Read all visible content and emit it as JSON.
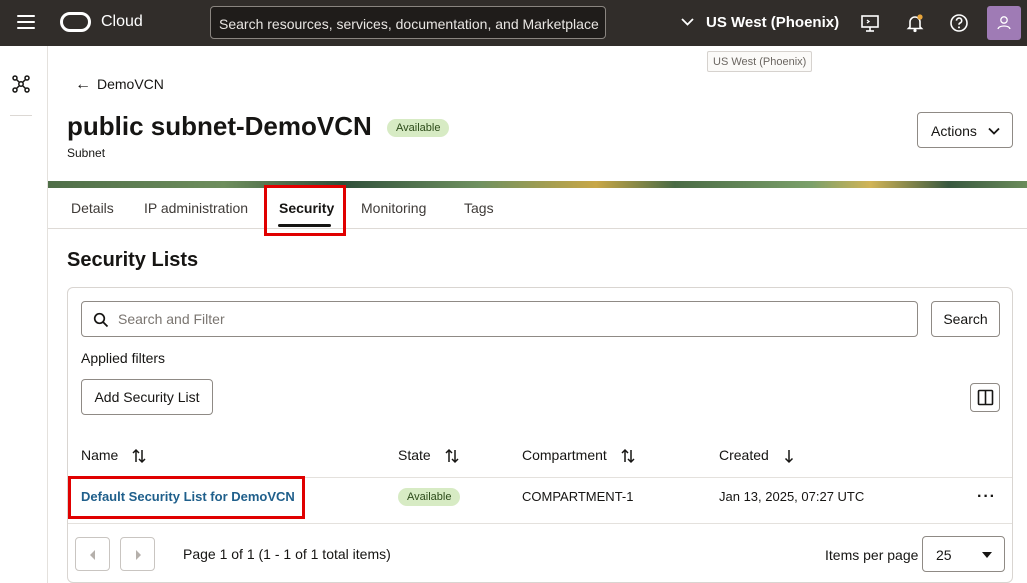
{
  "topbar": {
    "brand": "Cloud",
    "search_placeholder": "Search resources, services, documentation, and Marketplace",
    "region": "US West (Phoenix)",
    "region_tooltip": "US West (Phoenix)"
  },
  "header": {
    "back_label": "DemoVCN",
    "title": "public subnet-DemoVCN",
    "status": "Available",
    "subtitle": "Subnet",
    "actions_label": "Actions"
  },
  "tabs": [
    {
      "label": "Details"
    },
    {
      "label": "IP administration"
    },
    {
      "label": "Security",
      "active": true
    },
    {
      "label": "Monitoring"
    },
    {
      "label": "Tags"
    }
  ],
  "section": {
    "title": "Security Lists",
    "filter_placeholder": "Search and Filter",
    "search_button": "Search",
    "applied_filters": "Applied filters",
    "add_button": "Add Security List"
  },
  "table": {
    "columns": [
      "Name",
      "State",
      "Compartment",
      "Created"
    ],
    "rows": [
      {
        "name": "Default Security List for DemoVCN",
        "state": "Available",
        "compartment": "COMPARTMENT-1",
        "created": "Jan 13, 2025, 07:27 UTC"
      }
    ]
  },
  "pagination": {
    "info": "Page 1 of 1 (1 - 1 of 1 total items)",
    "items_per_page_label": "Items per page",
    "items_per_page": "25"
  },
  "colors": {
    "topbar_bg": "#312d2a",
    "link": "#1f5f8b",
    "badge_bg": "#d7ebc4",
    "highlight": "#e00000"
  }
}
